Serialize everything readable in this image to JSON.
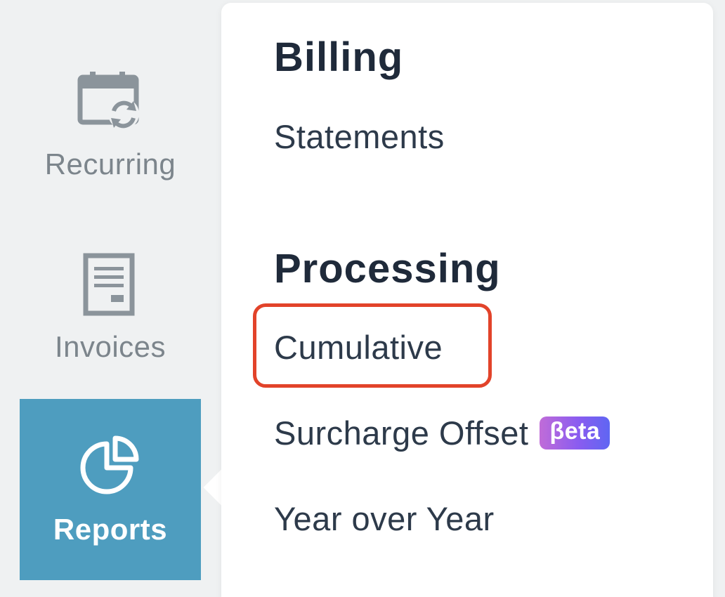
{
  "sidebar": {
    "items": [
      {
        "label": "Recurring",
        "icon": "calendar-recurring-icon",
        "active": false
      },
      {
        "label": "Invoices",
        "icon": "invoice-document-icon",
        "active": false
      },
      {
        "label": "Reports",
        "icon": "pie-chart-icon",
        "active": true
      }
    ]
  },
  "menu": {
    "billing": {
      "title": "Billing",
      "links": [
        "Statements"
      ]
    },
    "processing": {
      "title": "Processing",
      "links": [
        "Cumulative",
        "Surcharge Offset",
        "Year over Year"
      ],
      "badge": "βeta"
    }
  },
  "colors": {
    "active_nav": "#4e9dbf",
    "highlight": "#e2432a",
    "text_dark": "#1f2a3a",
    "nav_text": "#7c858c"
  }
}
